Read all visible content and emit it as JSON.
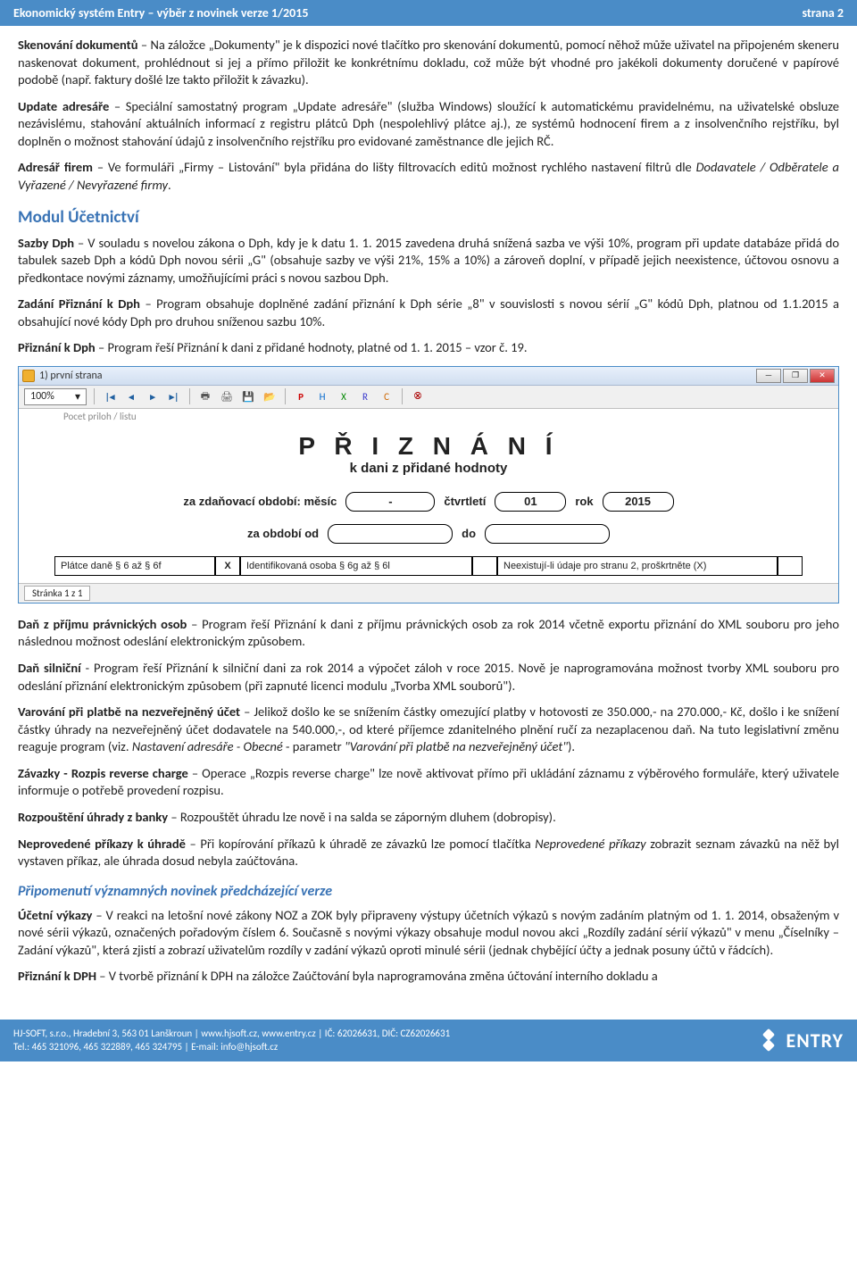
{
  "header": {
    "left": "Ekonomický systém Entry – výběr z novinek verze 1/2015",
    "right": "strana 2"
  },
  "paras": {
    "p1a": "Skenování dokumentů",
    "p1b": " – Na záložce „Dokumenty\" je k dispozici nové tlačítko pro skenování dokumentů, pomocí něhož může uživatel na připojeném skeneru naskenovat dokument, prohlédnout si jej a přímo přiložit ke konkrétnímu dokladu, což může být vhodné pro jakékoli dokumenty doručené v papírové podobě (např. faktury došlé lze takto přiložit k závazku).",
    "p2a": "Update adresáře",
    "p2b": " – Speciální samostatný program „Update adresáře\" (služba Windows) sloužící k automatickému pravidelnému, na uživatelské obsluze nezávislému, stahování aktuálních informací z registru plátců Dph (nespolehlivý plátce aj.), ze systémů hodnocení firem a z insolvenčního rejstříku, byl doplněn o možnost stahování údajů z insolvenčního rejstříku pro evidované zaměstnance dle jejich RČ.",
    "p3a": "Adresář firem",
    "p3b": " – Ve formuláři „Firmy – Listování\" byla přidána do lišty filtrovacích editů možnost rychlého nastavení filtrů dle ",
    "p3c": "Dodavatele / Odběratele a Vyřazené / Nevyřazené firmy",
    "s1": "Modul Účetnictví",
    "p4a": "Sazby Dph",
    "p4b": " – V souladu s novelou zákona o Dph, kdy je k datu 1. 1. 2015 zavedena druhá snížená sazba ve výši 10%, program při update databáze přidá do tabulek sazeb Dph a kódů Dph novou sérii „G\" (obsahuje sazby ve výši 21%, 15% a 10%) a zároveň doplní, v případě jejich neexistence, účtovou osnovu a předkontace novými záznamy, umožňujícími práci s novou sazbou Dph.",
    "p5a": "Zadání Přiznání k Dph",
    "p5b": " – Program obsahuje doplněné zadání přiznání k Dph série „8\" v souvislosti s novou sérií „G\" kódů Dph, platnou od 1.1.2015 a obsahující nové kódy Dph pro druhou sníženou sazbu 10%.",
    "p6a": "Přiznání k Dph",
    "p6b": " – Program řeší Přiznání k dani z přidané hodnoty, platné od 1. 1. 2015 – vzor č. 19.",
    "p7a": "Daň z příjmu právnických osob",
    "p7b": " – Program řeší Přiznání k dani z příjmu právnických osob za rok 2014 včetně exportu přiznání do XML souboru pro jeho následnou možnost odeslání elektronickým způsobem.",
    "p8a": "Daň silniční",
    "p8b": " - Program řeší Přiznání k silniční dani za rok 2014 a výpočet záloh v roce 2015. Nově je naprogramována možnost tvorby XML souboru pro odeslání přiznání elektronickým způsobem (při zapnuté licenci modulu „Tvorba XML souborů\").",
    "p9a": "Varování při platbě na nezveřejněný účet",
    "p9b": " – Jelikož došlo ke se snížením částky omezující platby v hotovosti ze 350.000,- na 270.000,- Kč, došlo i ke snížení částky úhrady na nezveřejněný účet dodavatele na 540.000,-, od které příjemce zdanitelného plnění ručí za nezaplacenou daň. Na tuto legislativní změnu reaguje program (viz. ",
    "p9c": "Nastavení adresáře - Obecné",
    "p9d": " - parametr ",
    "p9e": "\"Varování při platbě na nezveřejněný účet\"",
    "p10a": "Závazky - Rozpis reverse charge",
    "p10b": " – Operace „Rozpis reverse charge\" lze nově aktivovat přímo při ukládání záznamu z výběrového formuláře, který uživatele informuje o potřebě provedení rozpisu.",
    "p11a": "Rozpouštění úhrady z banky",
    "p11b": " – Rozpouštět úhradu lze nově i na salda se záporným dluhem (dobropisy).",
    "p12a": "Neprovedené příkazy k úhradě",
    "p12b": " – Při kopírování příkazů k úhradě ze závazků lze pomocí tlačítka ",
    "p12c": "Neprovedené příkazy",
    "p12d": " zobrazit seznam závazků na něž byl vystaven příkaz, ale úhrada dosud nebyla zaúčtována.",
    "s2": "Připomenutí významných novinek předcházející verze",
    "p13a": "Účetní výkazy",
    "p13b": " – V reakci na letošní nové zákony NOZ a ZOK byly připraveny výstupy účetních výkazů s novým zadáním platným od 1. 1. 2014, obsaženým v nové sérii výkazů, označených pořadovým číslem 6. Současně s novými výkazy obsahuje modul novou akci „Rozdíly zadání sérií výkazů\" v menu „Číselníky – Zadání výkazů\", která zjistí a zobrazí uživatelům rozdíly v zadání výkazů oproti minulé sérii (jednak chybějící účty a jednak posuny účtů v řádcích).",
    "p14a": "Přiznání k DPH",
    "p14b": " – V tvorbě přiznání k DPH na záložce Zaúčtování byla naprogramována změna účtování interního dokladu a"
  },
  "screenshot": {
    "win_title": "1) první strana",
    "zoom": "100%",
    "truncated": "Pocet priloh / listu",
    "title": "P Ř I Z N Á N Í",
    "subtitle": "k dani z přidané hodnoty",
    "row1": {
      "l1": "za zdaňovací období: měsíc",
      "v1": "-",
      "l2": "čtvrtletí",
      "v2": "01",
      "l3": "rok",
      "v3": "2015"
    },
    "row2": {
      "l1": "za období od",
      "l2": "do"
    },
    "bottom": {
      "c1": "Plátce daně § 6 až § 6f",
      "c2": "X",
      "c3": "Identifikovaná osoba § 6g až § 6l",
      "c4": "Neexistují-li údaje pro stranu 2, proškrtněte (X)"
    },
    "status": "Stránka 1 z 1"
  },
  "footer": {
    "line1": "HJ-SOFT, s.r.o., Hradební 3, 563 01 Lanškroun | www.hjsoft.cz, www.entry.cz | IČ: 62026631, DIČ: CZ62026631",
    "line2": "Tel.: 465 321096, 465 322889, 465 324795 | E-mail: info@hjsoft.cz",
    "logo": "ENTRY"
  }
}
